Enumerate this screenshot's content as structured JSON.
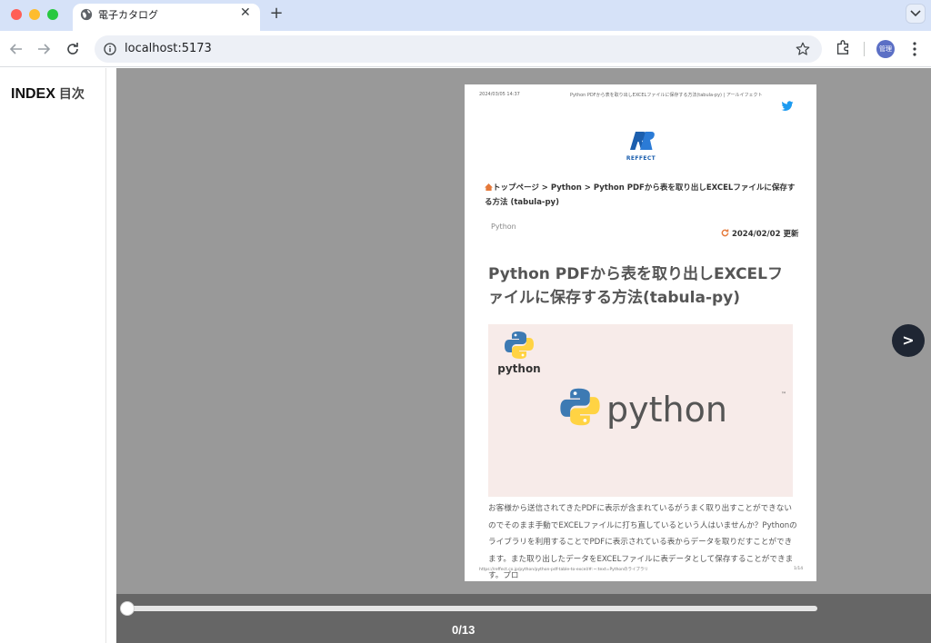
{
  "browser": {
    "tab_title": "電子カタログ",
    "tab_close": "✕",
    "new_tab": "+",
    "url": "localhost:5173",
    "avatar_label": "管理",
    "window_colors": {
      "close": "#ff5f57",
      "minimize": "#febc2e",
      "maximize": "#28c840"
    }
  },
  "sidebar": {
    "title": "INDEX",
    "subtitle": "目次"
  },
  "document_page": {
    "header_date": "2024/03/05 14:37",
    "header_title": "Python PDFから表を取り出しEXCELファイルに保存する方法(tabula-py) | アールイフェクト",
    "logo_text": "REFFECT",
    "breadcrumb": "トップページ > Python > Python PDFから表を取り出しEXCELファイルに保存する方法 (tabula-py)",
    "category": "Python",
    "updated": "2024/02/02 更新",
    "title": "Python PDFから表を取り出しEXCELファイルに保存する方法(tabula-py)",
    "hero_small_label": "python",
    "hero_big_label": "python",
    "hero_tm": "™",
    "body": "お客様から送信されてきたPDFに表示が含まれているがうまく取り出すことができないのでそのまま手動でEXCELファイルに打ち直しているという人はいませんか？Pythonのライブラリを利用することでPDFに表示されている表からデータを取りだすことができます。また取り出したデータをEXCELファイルに表データとして保存することができます。プロ",
    "footer_url": "https://reffect.co.jp/python/python-pdf-table-to-excel/#:~:text=Pythonのライブラリ",
    "footer_page": "1/14"
  },
  "viewer": {
    "next_label": ">",
    "current_page": 0,
    "total_pages": 13,
    "page_counter": "0/13",
    "progress": 0
  },
  "colors": {
    "accent_logo": "#1c5fae",
    "twitter": "#1d9bf0",
    "python_blue": "#3d7ab3",
    "python_yellow": "#ffd343",
    "viewer_bg": "#999999",
    "bottom_bar_bg": "#666666"
  },
  "icons": [
    "globe-icon",
    "close-icon",
    "plus-icon",
    "chevron-down-icon",
    "back-arrow-icon",
    "forward-arrow-icon",
    "reload-icon",
    "info-icon",
    "star-icon",
    "extensions-icon",
    "more-vert-icon",
    "twitter-icon",
    "reffect-logo",
    "home-icon",
    "refresh-icon",
    "python-logo"
  ]
}
